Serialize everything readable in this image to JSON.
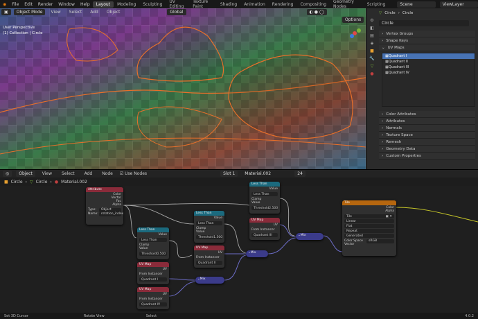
{
  "topbar": {
    "menus": [
      "File",
      "Edit",
      "Render",
      "Window",
      "Help"
    ],
    "tabs": [
      "Layout",
      "Modeling",
      "Sculpting",
      "UV Editing",
      "Texture Paint",
      "Shading",
      "Animation",
      "Rendering",
      "Compositing",
      "Geometry Nodes",
      "Scripting"
    ],
    "active_tab": "Layout",
    "scene": "Scene",
    "view_layer": "ViewLayer"
  },
  "viewport": {
    "mode": "Object Mode",
    "menus": [
      "View",
      "Select",
      "Add",
      "Object"
    ],
    "transform": "Global",
    "options": "Options",
    "overlay_line1": "User Perspective",
    "overlay_line2": "(1) Collection | Circle"
  },
  "properties": {
    "object": "Circle",
    "mesh": "Circle",
    "mesh_name": "Circle",
    "sections_top": [
      "Vertex Groups",
      "Shape Keys",
      "UV Maps"
    ],
    "uv_maps": [
      "Quadrant I",
      "Quadrant II",
      "Quadrant III",
      "Quadrant IV"
    ],
    "sections_bottom": [
      "Color Attributes",
      "Attributes",
      "Normals",
      "Texture Space",
      "Remesh",
      "Geometry Data",
      "Custom Properties"
    ]
  },
  "node_editor": {
    "type": "Object",
    "menus": [
      "View",
      "Select",
      "Add",
      "Node"
    ],
    "use_nodes": "Use Nodes",
    "slot": "Slot 1",
    "material": "Material.002",
    "users": "24",
    "breadcrumb": [
      "Circle",
      "Circle",
      "Material.002"
    ]
  },
  "nodes": {
    "attr": {
      "title": "Attribute",
      "outputs": [
        "Color",
        "Vector",
        "Fac",
        "Alpha"
      ],
      "type_label": "Type:",
      "type": "Object",
      "name_label": "Name:",
      "name": "rotation_index"
    },
    "lt1": {
      "title": "Less Than",
      "out": "Value",
      "op": "Less Than",
      "clamp": "Clamp",
      "in": "Value",
      "threshold": "Threshold",
      "thr_val": "0.500"
    },
    "lt2": {
      "title": "Less Than",
      "out": "Value",
      "op": "Less Than",
      "clamp": "Clamp",
      "in": "Value",
      "threshold": "Threshold",
      "thr_val": "1.500"
    },
    "lt3": {
      "title": "Less Than",
      "out": "Value",
      "op": "Less Than",
      "clamp": "Clamp",
      "in": "Value",
      "threshold": "Threshold",
      "thr_val": "2.500"
    },
    "uv1": {
      "title": "UV Map",
      "out": "UV",
      "inst": "From Instancer",
      "map": "Quadrant I"
    },
    "uv2": {
      "title": "UV Map",
      "out": "UV",
      "inst": "From Instancer",
      "map": "Quadrant II"
    },
    "uv3": {
      "title": "UV Map",
      "out": "UV",
      "inst": "From Instancer",
      "map": "Quadrant III"
    },
    "uv4": {
      "title": "UV Map",
      "out": "UV",
      "inst": "From Instancer",
      "map": "Quadrant IV"
    },
    "mix1": {
      "title": "Mix"
    },
    "mix2": {
      "title": "Mix"
    },
    "mix3": {
      "title": "Mix"
    },
    "tex": {
      "title": "Tile",
      "outputs": [
        "Color",
        "Alpha"
      ],
      "image": "Tile",
      "interp": "Linear",
      "proj": "Flat",
      "ext": "Repeat",
      "source": "Generated",
      "cs_label": "Color Space",
      "cs": "sRGB",
      "vector": "Vector"
    }
  },
  "status": {
    "left": "Set 3D Cursor",
    "mid": "Rotate View",
    "right": "Select",
    "version": "4.0.2"
  },
  "colors": {
    "accent": "#4772b3",
    "wire": "#e8702a",
    "node_header_blue": "#1b6a7e",
    "node_header_red": "#8a2b3a",
    "node_header_orange": "#b5660f",
    "node_header_purple": "#3b3b8a",
    "yellow_link": "#c7c729"
  }
}
